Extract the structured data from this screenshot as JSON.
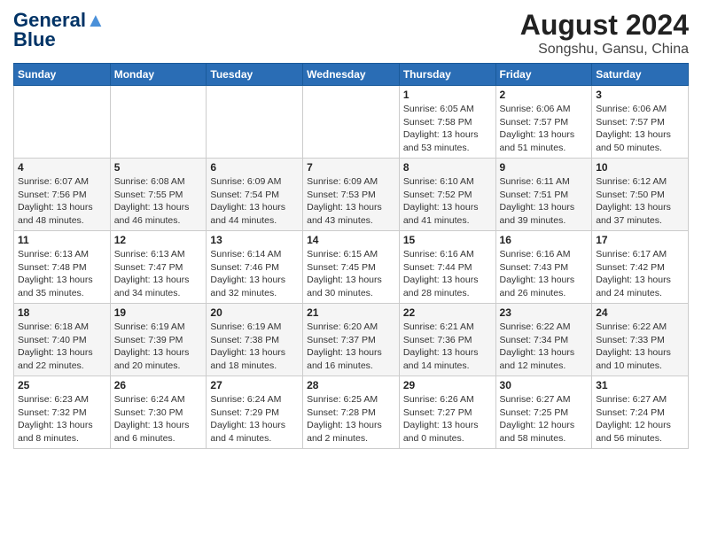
{
  "header": {
    "logo_line1": "General",
    "logo_line2": "Blue",
    "title": "August 2024",
    "subtitle": "Songshu, Gansu, China"
  },
  "calendar": {
    "days_of_week": [
      "Sunday",
      "Monday",
      "Tuesday",
      "Wednesday",
      "Thursday",
      "Friday",
      "Saturday"
    ],
    "weeks": [
      [
        {
          "day": "",
          "info": ""
        },
        {
          "day": "",
          "info": ""
        },
        {
          "day": "",
          "info": ""
        },
        {
          "day": "",
          "info": ""
        },
        {
          "day": "1",
          "info": "Sunrise: 6:05 AM\nSunset: 7:58 PM\nDaylight: 13 hours\nand 53 minutes."
        },
        {
          "day": "2",
          "info": "Sunrise: 6:06 AM\nSunset: 7:57 PM\nDaylight: 13 hours\nand 51 minutes."
        },
        {
          "day": "3",
          "info": "Sunrise: 6:06 AM\nSunset: 7:57 PM\nDaylight: 13 hours\nand 50 minutes."
        }
      ],
      [
        {
          "day": "4",
          "info": "Sunrise: 6:07 AM\nSunset: 7:56 PM\nDaylight: 13 hours\nand 48 minutes."
        },
        {
          "day": "5",
          "info": "Sunrise: 6:08 AM\nSunset: 7:55 PM\nDaylight: 13 hours\nand 46 minutes."
        },
        {
          "day": "6",
          "info": "Sunrise: 6:09 AM\nSunset: 7:54 PM\nDaylight: 13 hours\nand 44 minutes."
        },
        {
          "day": "7",
          "info": "Sunrise: 6:09 AM\nSunset: 7:53 PM\nDaylight: 13 hours\nand 43 minutes."
        },
        {
          "day": "8",
          "info": "Sunrise: 6:10 AM\nSunset: 7:52 PM\nDaylight: 13 hours\nand 41 minutes."
        },
        {
          "day": "9",
          "info": "Sunrise: 6:11 AM\nSunset: 7:51 PM\nDaylight: 13 hours\nand 39 minutes."
        },
        {
          "day": "10",
          "info": "Sunrise: 6:12 AM\nSunset: 7:50 PM\nDaylight: 13 hours\nand 37 minutes."
        }
      ],
      [
        {
          "day": "11",
          "info": "Sunrise: 6:13 AM\nSunset: 7:48 PM\nDaylight: 13 hours\nand 35 minutes."
        },
        {
          "day": "12",
          "info": "Sunrise: 6:13 AM\nSunset: 7:47 PM\nDaylight: 13 hours\nand 34 minutes."
        },
        {
          "day": "13",
          "info": "Sunrise: 6:14 AM\nSunset: 7:46 PM\nDaylight: 13 hours\nand 32 minutes."
        },
        {
          "day": "14",
          "info": "Sunrise: 6:15 AM\nSunset: 7:45 PM\nDaylight: 13 hours\nand 30 minutes."
        },
        {
          "day": "15",
          "info": "Sunrise: 6:16 AM\nSunset: 7:44 PM\nDaylight: 13 hours\nand 28 minutes."
        },
        {
          "day": "16",
          "info": "Sunrise: 6:16 AM\nSunset: 7:43 PM\nDaylight: 13 hours\nand 26 minutes."
        },
        {
          "day": "17",
          "info": "Sunrise: 6:17 AM\nSunset: 7:42 PM\nDaylight: 13 hours\nand 24 minutes."
        }
      ],
      [
        {
          "day": "18",
          "info": "Sunrise: 6:18 AM\nSunset: 7:40 PM\nDaylight: 13 hours\nand 22 minutes."
        },
        {
          "day": "19",
          "info": "Sunrise: 6:19 AM\nSunset: 7:39 PM\nDaylight: 13 hours\nand 20 minutes."
        },
        {
          "day": "20",
          "info": "Sunrise: 6:19 AM\nSunset: 7:38 PM\nDaylight: 13 hours\nand 18 minutes."
        },
        {
          "day": "21",
          "info": "Sunrise: 6:20 AM\nSunset: 7:37 PM\nDaylight: 13 hours\nand 16 minutes."
        },
        {
          "day": "22",
          "info": "Sunrise: 6:21 AM\nSunset: 7:36 PM\nDaylight: 13 hours\nand 14 minutes."
        },
        {
          "day": "23",
          "info": "Sunrise: 6:22 AM\nSunset: 7:34 PM\nDaylight: 13 hours\nand 12 minutes."
        },
        {
          "day": "24",
          "info": "Sunrise: 6:22 AM\nSunset: 7:33 PM\nDaylight: 13 hours\nand 10 minutes."
        }
      ],
      [
        {
          "day": "25",
          "info": "Sunrise: 6:23 AM\nSunset: 7:32 PM\nDaylight: 13 hours\nand 8 minutes."
        },
        {
          "day": "26",
          "info": "Sunrise: 6:24 AM\nSunset: 7:30 PM\nDaylight: 13 hours\nand 6 minutes."
        },
        {
          "day": "27",
          "info": "Sunrise: 6:24 AM\nSunset: 7:29 PM\nDaylight: 13 hours\nand 4 minutes."
        },
        {
          "day": "28",
          "info": "Sunrise: 6:25 AM\nSunset: 7:28 PM\nDaylight: 13 hours\nand 2 minutes."
        },
        {
          "day": "29",
          "info": "Sunrise: 6:26 AM\nSunset: 7:27 PM\nDaylight: 13 hours\nand 0 minutes."
        },
        {
          "day": "30",
          "info": "Sunrise: 6:27 AM\nSunset: 7:25 PM\nDaylight: 12 hours\nand 58 minutes."
        },
        {
          "day": "31",
          "info": "Sunrise: 6:27 AM\nSunset: 7:24 PM\nDaylight: 12 hours\nand 56 minutes."
        }
      ]
    ]
  }
}
